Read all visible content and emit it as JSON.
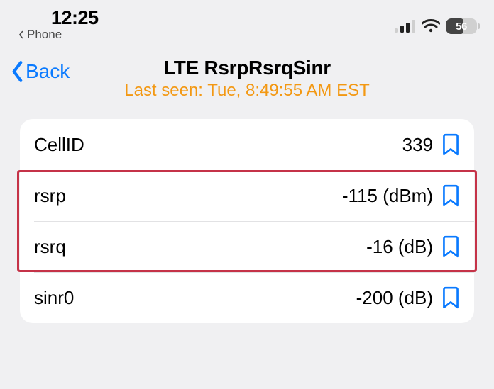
{
  "status": {
    "time": "12:25",
    "back_app_label": "Phone",
    "battery_text": "56"
  },
  "nav": {
    "back_label": "Back",
    "title": "LTE RsrpRsrqSinr",
    "subtitle": "Last seen: Tue, 8:49:55 AM EST"
  },
  "rows": [
    {
      "label": "CellID",
      "value": "339"
    },
    {
      "label": "rsrp",
      "value": "-115 (dBm)"
    },
    {
      "label": "rsrq",
      "value": "-16 (dB)"
    },
    {
      "label": "sinr0",
      "value": "-200 (dB)"
    }
  ]
}
